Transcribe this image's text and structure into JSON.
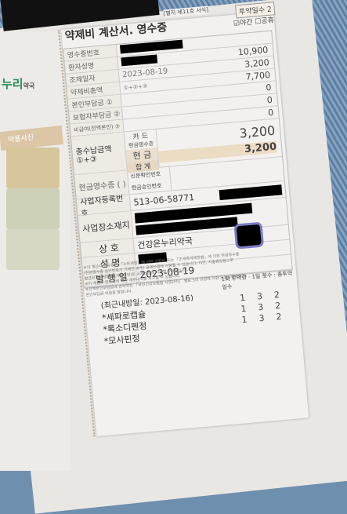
{
  "receipt": {
    "title": "약제비 계산서. 영수증",
    "form_no": "[별지 제11호 서식]",
    "dispensing_days_label": "투약일수",
    "dispensing_days": "2",
    "night_label": "야간",
    "holiday_label": "공휴",
    "night_checked": true,
    "rows": [
      {
        "label": "영수증번호",
        "middle": "",
        "value": ""
      },
      {
        "label": "환자성명",
        "middle": "",
        "value": "10,900"
      },
      {
        "label": "조제일자",
        "middle": "2023-08-19",
        "value": "3,200"
      },
      {
        "label": "약제비총액",
        "middle": "①+②+③",
        "value": "7,700"
      },
      {
        "label": "본인부담금 ①",
        "middle": "",
        "value": "0"
      },
      {
        "label": "보험자부담금 ②",
        "middle": "",
        "value": "0"
      },
      {
        "label": "비급여(전액본인) ③",
        "middle": "",
        "value": "0"
      }
    ],
    "total_paid_label": "총수납금액 ①+③",
    "card_label": "카 드",
    "cash_receipt_label": "현금영수증",
    "cash_label": "현 금",
    "card_value": "3,200",
    "cash_value": "3,200",
    "sum_label": "합 계",
    "cash_receipt_section_label": "현금영수증 (   )",
    "id_label": "신분확인번호",
    "approval_label": "현금승인번호",
    "business_reg_label": "사업자등록번호",
    "business_reg_no": "513-06-58771",
    "address_label": "사업장소재지",
    "store_label": "상 호",
    "store_name": "건강온누리약국",
    "owner_label": "성 명",
    "issue_label": "발 행 일",
    "issue_date": "2023-08-19",
    "notes": [
      "※이 계산서·영수증은 「소득세법」에 의한 의료비 또는 「조세특례제한법」에 의한 현금영수증",
      "(현금영수증 승인번호가 기재된 경우) 공제신청에 사용할 수 있습니다. 다만, 지출증빙용으로",
      "발급된 현금영수증(지출증빙)은 공제신청에 사용할 수 없습니다.",
      "※이 계산서·영수증에 대한 세부내역을 요구할 수 있습니다.",
      "※선택본인부담금에 관하여는 「국민건강보험법 시행규칙」 별표 5의 규정에 의한 요양급여비용의",
      "본인부담금 비용을 말합니다."
    ],
    "columns": [
      "1회 투약량",
      "1일 횟수",
      "총투약 일수"
    ],
    "recent_visit": "(최근내방일: 2023-08-16)",
    "drugs": [
      {
        "name": "*세파로캡슐",
        "dose": "1",
        "times": "3",
        "days": "2"
      },
      {
        "name": "*록소디펜정",
        "dose": "1",
        "times": "3",
        "days": "2"
      },
      {
        "name": "*모사핀정",
        "dose": "1",
        "times": "3",
        "days": "2"
      }
    ]
  },
  "leaflet": {
    "logo": "누리",
    "logo_suffix": "약국",
    "photo_header": "약품사진"
  }
}
